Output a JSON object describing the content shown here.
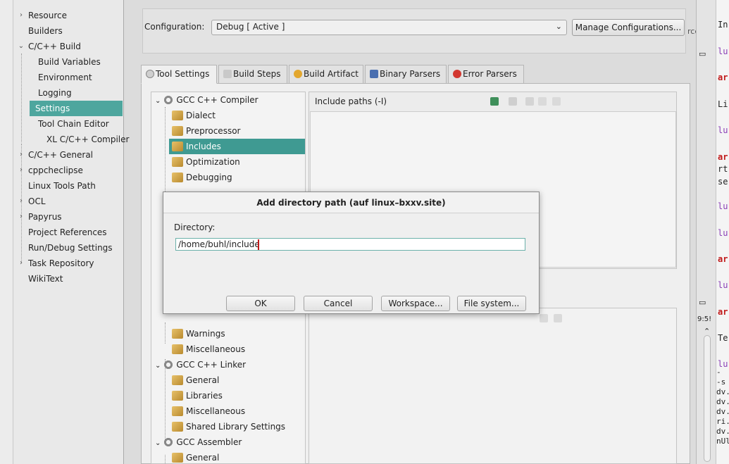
{
  "sidebar": {
    "items": [
      {
        "label": "Resource",
        "arrow": "›"
      },
      {
        "label": "Builders",
        "arrow": ""
      },
      {
        "label": "C/C++ Build",
        "arrow": "⌄"
      },
      {
        "label": "Build Variables",
        "arrow": ""
      },
      {
        "label": "Environment",
        "arrow": ""
      },
      {
        "label": "Logging",
        "arrow": ""
      },
      {
        "label": "Settings",
        "arrow": ""
      },
      {
        "label": "Tool Chain Editor",
        "arrow": ""
      },
      {
        "label": "XL C/C++ Compiler",
        "arrow": ""
      },
      {
        "label": "C/C++ General",
        "arrow": "›"
      },
      {
        "label": "cppcheclipse",
        "arrow": "›"
      },
      {
        "label": "Linux Tools Path",
        "arrow": ""
      },
      {
        "label": "OCL",
        "arrow": "›"
      },
      {
        "label": "Papyrus",
        "arrow": "›"
      },
      {
        "label": "Project References",
        "arrow": ""
      },
      {
        "label": "Run/Debug Settings",
        "arrow": ""
      },
      {
        "label": "Task Repository",
        "arrow": "›"
      },
      {
        "label": "WikiText",
        "arrow": ""
      }
    ]
  },
  "config": {
    "label": "Configuration:",
    "value": "Debug  [ Active ]",
    "manage_button": "Manage Configurations...",
    "cut_text": "rce"
  },
  "tabs": [
    {
      "label": "Tool Settings",
      "icon": "gear-icon"
    },
    {
      "label": "Build Steps",
      "icon": "steps-icon"
    },
    {
      "label": "Build Artifact",
      "icon": "artifact-icon"
    },
    {
      "label": "Binary Parsers",
      "icon": "binary-icon"
    },
    {
      "label": "Error Parsers",
      "icon": "error-icon"
    }
  ],
  "tool_tree": {
    "items": [
      {
        "label": "GCC C++ Compiler",
        "kind": "group"
      },
      {
        "label": "Dialect",
        "kind": "leaf"
      },
      {
        "label": "Preprocessor",
        "kind": "leaf"
      },
      {
        "label": "Includes",
        "kind": "leaf"
      },
      {
        "label": "Optimization",
        "kind": "leaf"
      },
      {
        "label": "Debugging",
        "kind": "leaf"
      },
      {
        "label": "Warnings",
        "kind": "leaf"
      },
      {
        "label": "Miscellaneous",
        "kind": "leaf"
      },
      {
        "label": "GCC C++ Linker",
        "kind": "group"
      },
      {
        "label": "General",
        "kind": "leaf"
      },
      {
        "label": "Libraries",
        "kind": "leaf"
      },
      {
        "label": "Miscellaneous",
        "kind": "leaf"
      },
      {
        "label": "Shared Library Settings",
        "kind": "leaf"
      },
      {
        "label": "GCC Assembler",
        "kind": "group"
      },
      {
        "label": "General",
        "kind": "leaf"
      }
    ]
  },
  "include_panel": {
    "title": "Include paths (-I)"
  },
  "dialog": {
    "title": "Add directory path  (auf linux–bxxv.site)",
    "label": "Directory:",
    "value": "/home/buhl/include",
    "buttons": {
      "ok": "OK",
      "cancel": "Cancel",
      "workspace": "Workspace...",
      "filesystem": "File system..."
    }
  },
  "editor": {
    "lines": [
      {
        "text": "In",
        "color": "#222222"
      },
      {
        "text": "lu",
        "color": "#8a3fb5"
      },
      {
        "text": "ar",
        "color": "#c01818"
      },
      {
        "text": "Li",
        "color": "#222222"
      },
      {
        "text": "lu",
        "color": "#8a3fb5"
      },
      {
        "text": "ar",
        "color": "#c01818"
      },
      {
        "text": "rt",
        "color": "#222222"
      },
      {
        "text": "se",
        "color": "#222222"
      },
      {
        "text": "lu",
        "color": "#8a3fb5"
      },
      {
        "text": "lu",
        "color": "#8a3fb5"
      },
      {
        "text": "ar",
        "color": "#c01818"
      },
      {
        "text": "lu",
        "color": "#8a3fb5"
      },
      {
        "text": "ar",
        "color": "#c01818"
      },
      {
        "text": "Te",
        "color": "#222222"
      },
      {
        "text": "lu",
        "color": "#8a3fb5"
      }
    ],
    "time": "9:5!",
    "console": [
      " -",
      "-s",
      "dv.",
      "dv.",
      "dv.",
      "ri.",
      "dv.",
      "nUl"
    ]
  },
  "colors": {
    "selected": "#4ea69e",
    "accent": "#3f9a92"
  }
}
